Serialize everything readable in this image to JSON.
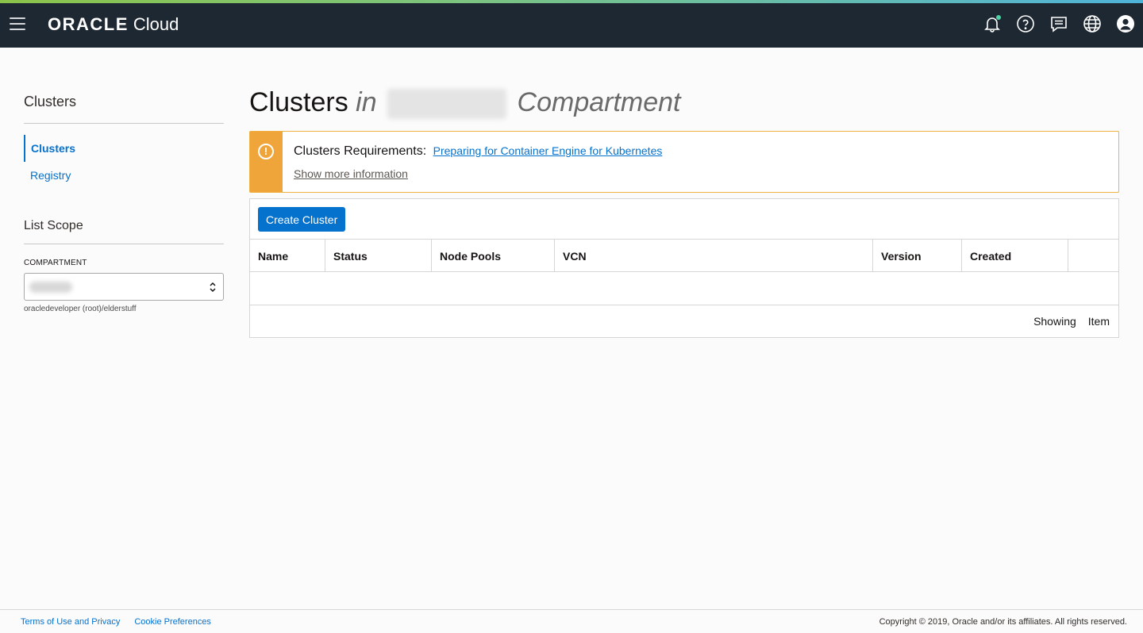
{
  "header": {
    "brand": "ORACLE",
    "product": "Cloud",
    "icons": [
      "bell-icon",
      "help-icon",
      "chat-icon",
      "globe-icon",
      "user-icon"
    ],
    "colors": {
      "bar": "#1e2832",
      "accent": "#0572ce",
      "notification": "#4fd1a6"
    }
  },
  "sidebar": {
    "title": "Clusters",
    "items": [
      {
        "label": "Clusters",
        "active": true
      },
      {
        "label": "Registry",
        "active": false
      }
    ],
    "scope_title": "List Scope",
    "compartment_label": "COMPARTMENT",
    "compartment_path": "oracledeveloper (root)/elderstuff"
  },
  "main": {
    "title_prefix": "Clusters",
    "title_in": "in",
    "title_suffix": "Compartment",
    "alert": {
      "label": "Clusters Requirements:",
      "link": "Preparing for Container Engine for Kubernetes",
      "more": "Show more information",
      "color": "#f0a53a"
    },
    "create_button": "Create Cluster",
    "columns": [
      "Name",
      "Status",
      "Node Pools",
      "VCN",
      "Version",
      "Created",
      ""
    ],
    "rows": [],
    "footer": {
      "showing": "Showing",
      "item": "Item"
    }
  },
  "footer": {
    "links": [
      "Terms of Use and Privacy",
      "Cookie Preferences"
    ],
    "copyright": "Copyright © 2019, Oracle and/or its affiliates. All rights reserved."
  }
}
